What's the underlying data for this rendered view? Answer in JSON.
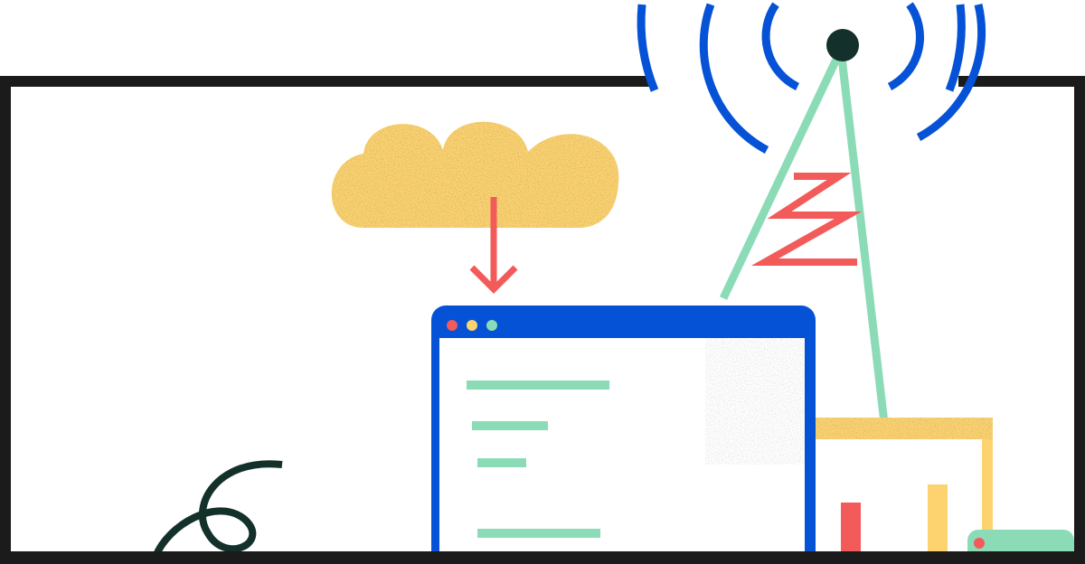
{
  "illustration": {
    "frame": {
      "color": "#1b1b1b"
    },
    "cloud": {
      "color": "#fdd36f"
    },
    "download_arrow": {
      "color": "#f35a5a"
    },
    "browser_window": {
      "frame_color": "#0552d6",
      "dots": [
        {
          "name": "red-dot",
          "color": "#f35a5a"
        },
        {
          "name": "yellow-dot",
          "color": "#fdd36f"
        },
        {
          "name": "green-dot",
          "color": "#8bdbb7"
        }
      ],
      "text_line_color": "#8bdbb7",
      "text_line_count": 4
    },
    "antenna_tower": {
      "color": "#8bdbb7",
      "zigzag_color": "#f35a5a",
      "tip_color": "#13302b"
    },
    "signal_waves": {
      "color": "#0552d6",
      "rings": 3
    },
    "building": {
      "color": "#fdd36f",
      "bar_colors": [
        "#f35a5a",
        "#fdd36f"
      ]
    },
    "small_device": {
      "color": "#8bdbb7",
      "dot_color": "#f35a5a"
    },
    "squiggle": {
      "color": "#13302b"
    }
  }
}
